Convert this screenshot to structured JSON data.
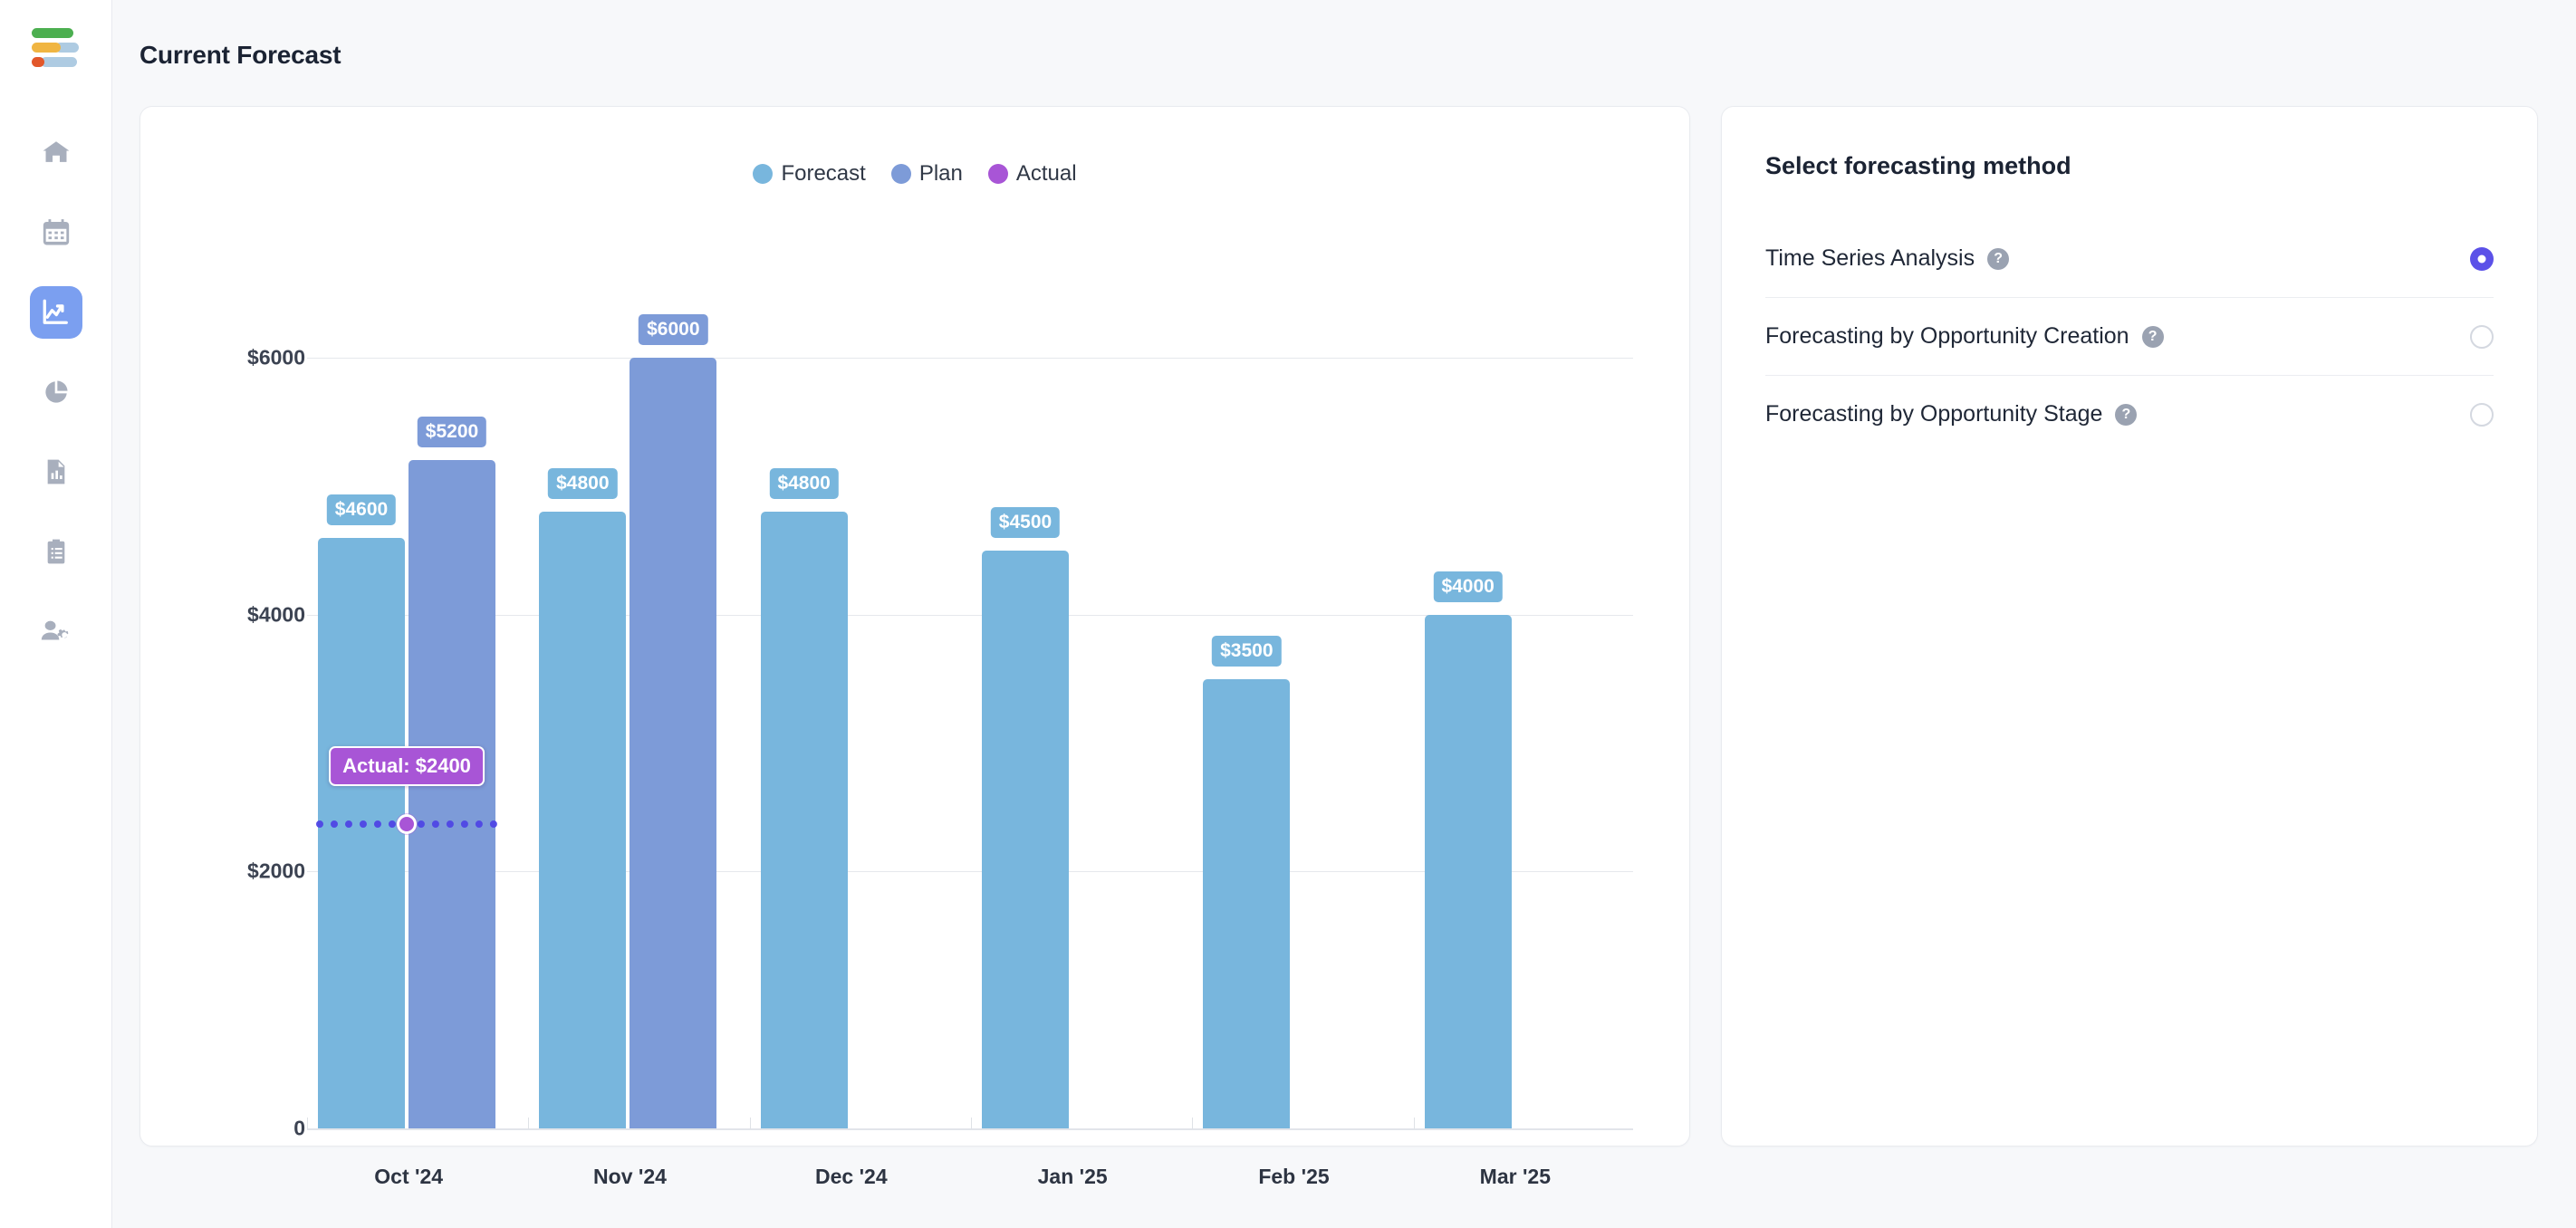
{
  "app": {
    "logo": {
      "name": "analytics-logo",
      "bars": [
        {
          "color": "#4caf50",
          "width": 46,
          "tail": 0
        },
        {
          "color": "#f0b542",
          "width": 30,
          "tail": 46
        },
        {
          "color": "#e2572a",
          "width": 13,
          "tail": 46
        }
      ]
    },
    "nav": [
      {
        "icon": "home-icon",
        "label": "Home",
        "active": false
      },
      {
        "icon": "calendar-icon",
        "label": "Calendar",
        "active": false
      },
      {
        "icon": "line-chart-icon",
        "label": "Forecast",
        "active": true
      },
      {
        "icon": "pie-chart-icon",
        "label": "Analytics",
        "active": false
      },
      {
        "icon": "report-icon",
        "label": "Reports",
        "active": false
      },
      {
        "icon": "clipboard-icon",
        "label": "Tasks",
        "active": false
      },
      {
        "icon": "user-settings-icon",
        "label": "Team Settings",
        "active": false
      }
    ]
  },
  "header": {
    "title": "Current Forecast"
  },
  "chart_data": {
    "type": "bar",
    "title": "Current Forecast",
    "xlabel": "",
    "ylabel": "",
    "ylim": [
      0,
      6400
    ],
    "grid": true,
    "legend_position": "top-center",
    "y_ticks": [
      {
        "value": 6000,
        "label": "$6000"
      },
      {
        "value": 4000,
        "label": "$4000"
      },
      {
        "value": 2000,
        "label": "$2000"
      },
      {
        "value": 0,
        "label": "0"
      }
    ],
    "categories": [
      "Oct '24",
      "Nov '24",
      "Dec '24",
      "Jan '25",
      "Feb '25",
      "Mar '25"
    ],
    "series": [
      {
        "name": "Forecast",
        "color": "#78b6dd",
        "values": [
          4600,
          4800,
          4800,
          4500,
          3500,
          4000
        ],
        "labels": [
          "$4600",
          "$4800",
          "$4800",
          "$4500",
          "$3500",
          "$4000"
        ]
      },
      {
        "name": "Plan",
        "color": "#7d9bd8",
        "values": [
          5200,
          6000,
          null,
          null,
          null,
          null
        ],
        "labels": [
          "$5200",
          "$6000",
          null,
          null,
          null,
          null
        ]
      },
      {
        "name": "Actual",
        "color": "#a855d6",
        "type": "line",
        "values": [
          2400,
          null,
          null,
          null,
          null,
          null
        ],
        "tooltip": "Actual: $2400"
      }
    ],
    "legend": [
      {
        "label": "Forecast",
        "color": "#78b6dd"
      },
      {
        "label": "Plan",
        "color": "#7d9bd8"
      },
      {
        "label": "Actual",
        "color": "#a855d6"
      }
    ]
  },
  "method_panel": {
    "title": "Select forecasting method",
    "help_glyph": "?",
    "selected_color": "#5b51e8",
    "options": [
      {
        "label": "Time Series Analysis",
        "selected": true
      },
      {
        "label": "Forecasting by Opportunity Creation",
        "selected": false
      },
      {
        "label": "Forecasting by Opportunity Stage",
        "selected": false
      }
    ]
  }
}
